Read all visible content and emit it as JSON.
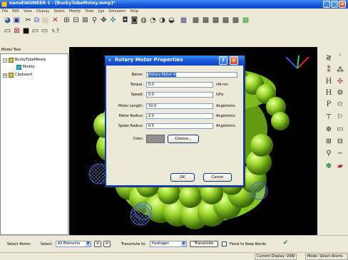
{
  "window": {
    "title": "nanoENGINEER-1 - [BuckyTubeMotey.mmp]*",
    "controls": [
      "_",
      "□",
      "×"
    ]
  },
  "menu": [
    "File",
    "Edit",
    "View",
    "Display",
    "Select",
    "Modify",
    "Tools",
    "Jigs",
    "Simulator",
    "Help"
  ],
  "toolbar": {
    "row1_icons": [
      "open-icon",
      "save-icon",
      "cut-icon",
      "copy-icon",
      "paste-icon",
      "delete-icon",
      "view-front-icon",
      "view-back-icon",
      "zoom-box-icon",
      "zoom-icon",
      "pan-icon",
      "rotate-icon",
      "display-default-icon",
      "display-invisible-icon",
      "display-cpk-icon",
      "display-lines-icon",
      "display-tubes-icon",
      "display-vdw-icon",
      "color-icon",
      "element-1-icon",
      "element-2-icon",
      "element-3-icon",
      "element-4-icon",
      "element-5-icon",
      "element-6-icon"
    ],
    "row2_icons": [
      "grid-icon",
      "mode-x-icon",
      "mode-dark-icon",
      "select-a-icon",
      "select-b-icon",
      "whats-this-icon"
    ]
  },
  "model_tree": {
    "label": "Model Tree",
    "items": [
      {
        "label": "BuckyTubeMoiety",
        "expander": "−"
      },
      {
        "label": "Moiety"
      },
      {
        "label": "Clipboard",
        "expander": "+"
      }
    ]
  },
  "palette_icons": [
    "palette-1-icon",
    "palette-2-icon",
    "palette-3-icon",
    "palette-4-icon",
    "palette-5-icon",
    "palette-6-icon",
    "palette-7-icon",
    "palette-8-icon",
    "palette-9-icon",
    "palette-10-icon",
    "palette-11-icon",
    "palette-12-icon",
    "palette-13-icon",
    "palette-14-icon",
    "palette-15-icon",
    "palette-16-icon",
    "palette-17-icon",
    "palette-18-icon",
    "palette-19-icon",
    "palette-20-icon"
  ],
  "dialog": {
    "title": "Rotary Motor Properties",
    "help_label": "?",
    "close_label": "×",
    "name_label": "Name:",
    "name_value": "Rotary Motor 4",
    "torque_label": "Torque:",
    "torque_value": "0.0",
    "torque_unit": "nN-nm",
    "speed_label": "Speed:",
    "speed_value": "0.0",
    "speed_unit": "GHz",
    "length_label": "Motor Length:",
    "length_value": "10.0",
    "length_unit": "Angstroms",
    "radius_label": "Motor Radius:",
    "radius_value": "2.0",
    "radius_unit": "Angstroms",
    "spoke_label": "Spoke Radius:",
    "spoke_value": "0.5",
    "spoke_unit": "Angstroms",
    "color_label": "Color:",
    "color_value": "#8f8f8f",
    "choose_label": "Choose...",
    "ok_label": "OK",
    "cancel_label": "Cancel"
  },
  "selection_bar": {
    "select_atoms_label": "Select Atoms",
    "select_label": "Select:",
    "select_value": "All Elements",
    "transmute_to_label": "Transmute to:",
    "transmute_value": "Hydrogen",
    "transmute_button": "Transmute",
    "force_bonds_label": "Force to Keep Bonds"
  },
  "status": {
    "display": "Current Display: VdW",
    "mode": "Mode: Select Atoms"
  },
  "colors": {
    "title_blue": "#1456d6",
    "viewport_bg": "#000000",
    "tube_green": "#8ed12c",
    "motor_blue": "#2d3f9a"
  }
}
